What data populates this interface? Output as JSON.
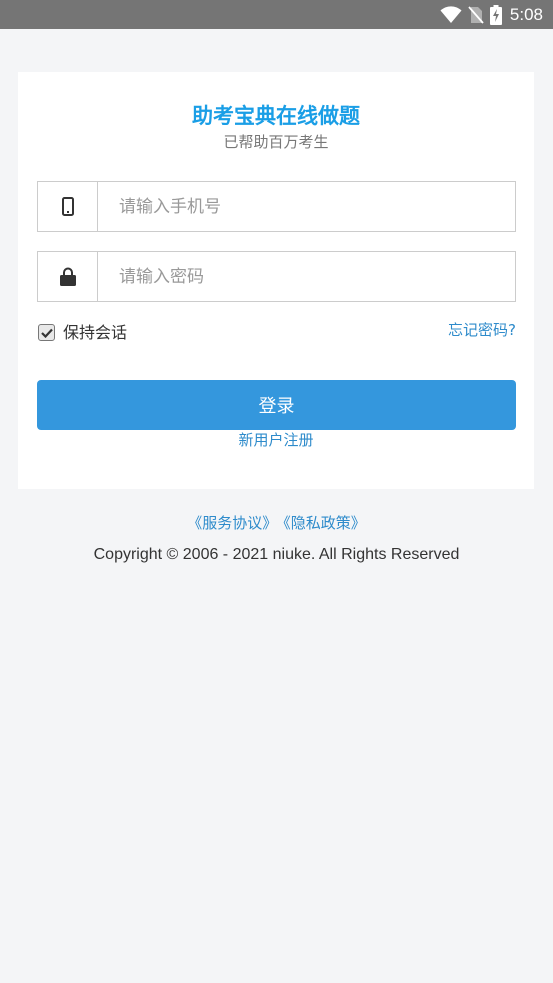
{
  "status_bar": {
    "time": "5:08",
    "icons": [
      "wifi-icon",
      "no-sim-icon",
      "battery-charging-icon"
    ]
  },
  "login_card": {
    "title": "助考宝典在线做题",
    "subtitle": "已帮助百万考生",
    "phone_field": {
      "icon": "mobile-phone-icon",
      "placeholder": "请输入手机号",
      "value": ""
    },
    "password_field": {
      "icon": "lock-icon",
      "placeholder": "请输入密码",
      "value": ""
    },
    "remember": {
      "label": "保持会话",
      "checked": true
    },
    "forgot_password": "忘记密码?",
    "login_button": "登录",
    "register_link": "新用户注册"
  },
  "footer": {
    "terms_link": "《服务协议》",
    "privacy_link": "《隐私政策》",
    "copyright": "Copyright © 2006 - 2021 niuke. All Rights Reserved"
  },
  "colors": {
    "title": "#1a9ee6",
    "primary_button": "#3497dd",
    "link": "#2e8bcb",
    "page_background": "#f4f5f7",
    "status_bar": "#757575"
  }
}
